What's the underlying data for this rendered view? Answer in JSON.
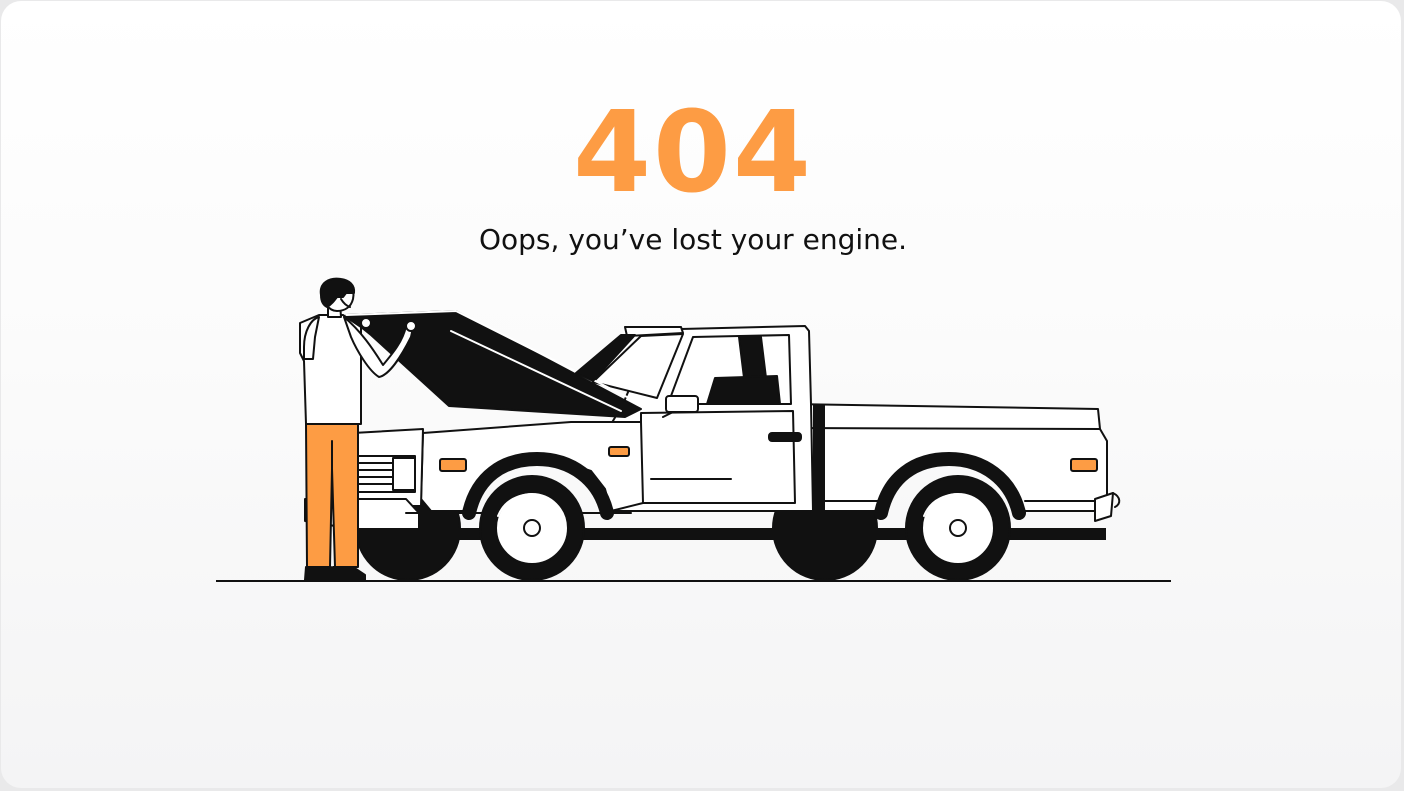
{
  "error": {
    "code": "404",
    "message": "Oops, you’ve lost your engine."
  },
  "illustration": {
    "subject": "man looking under the open hood of a pickup truck",
    "icons": [
      "pickup-truck-icon",
      "mechanic-person-icon"
    ]
  },
  "colors": {
    "accent": "#fd9c44",
    "text": "#111111",
    "outline": "#111111",
    "background": "#fbfbfb"
  }
}
